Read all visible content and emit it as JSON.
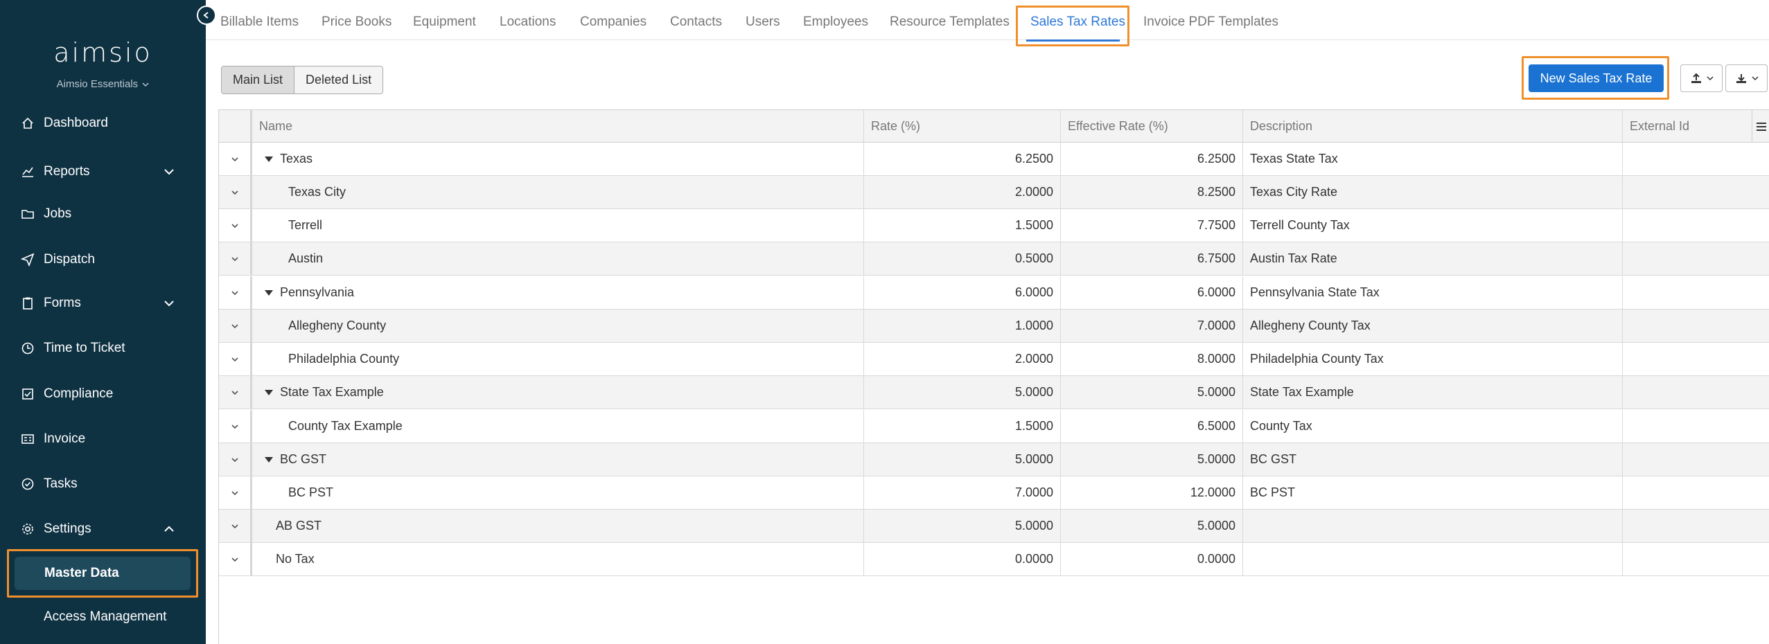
{
  "sidebar": {
    "logo": "aimsio",
    "org": "Aimsio Essentials",
    "items": [
      {
        "label": "Dashboard",
        "icon": "home-icon"
      },
      {
        "label": "Reports",
        "icon": "chart-icon"
      },
      {
        "label": "Jobs",
        "icon": "folder-icon"
      },
      {
        "label": "Dispatch",
        "icon": "send-icon"
      },
      {
        "label": "Forms",
        "icon": "clipboard-icon"
      },
      {
        "label": "Time to Ticket",
        "icon": "clock-icon"
      },
      {
        "label": "Compliance",
        "icon": "compliance-icon"
      },
      {
        "label": "Invoice",
        "icon": "invoice-icon"
      },
      {
        "label": "Tasks",
        "icon": "check-circle-icon"
      },
      {
        "label": "Settings",
        "icon": "gear-icon"
      }
    ],
    "active_item": "Master Data",
    "sub_item": "Access Management"
  },
  "tabs": [
    "Billable Items",
    "Price Books",
    "Equipment",
    "Locations",
    "Companies",
    "Contacts",
    "Users",
    "Employees",
    "Resource Templates",
    "Sales Tax Rates",
    "Invoice PDF Templates"
  ],
  "active_tab": "Sales Tax Rates",
  "toolbar": {
    "main_list": "Main List",
    "deleted_list": "Deleted List",
    "new_button": "New Sales Tax Rate"
  },
  "colors": {
    "sidebar_bg": "#0f3243",
    "accent_blue": "#1a73d2",
    "highlight_orange": "#f0902c"
  },
  "table": {
    "columns": [
      "Name",
      "Rate (%)",
      "Effective Rate (%)",
      "Description",
      "External Id"
    ],
    "rows": [
      {
        "name": "Texas",
        "rate": "6.2500",
        "effective": "6.2500",
        "description": "Texas State Tax",
        "external_id": "",
        "parent": true
      },
      {
        "name": "Texas City",
        "rate": "2.0000",
        "effective": "8.2500",
        "description": "Texas City Rate",
        "external_id": "",
        "child": true
      },
      {
        "name": "Terrell",
        "rate": "1.5000",
        "effective": "7.7500",
        "description": "Terrell County Tax",
        "external_id": "",
        "child": true
      },
      {
        "name": "Austin",
        "rate": "0.5000",
        "effective": "6.7500",
        "description": "Austin Tax Rate",
        "external_id": "",
        "child": true
      },
      {
        "name": "Pennsylvania",
        "rate": "6.0000",
        "effective": "6.0000",
        "description": "Pennsylvania State Tax",
        "external_id": "",
        "parent": true
      },
      {
        "name": "Allegheny County",
        "rate": "1.0000",
        "effective": "7.0000",
        "description": "Allegheny County Tax",
        "external_id": "",
        "child": true
      },
      {
        "name": "Philadelphia County",
        "rate": "2.0000",
        "effective": "8.0000",
        "description": "Philadelphia County Tax",
        "external_id": "",
        "child": true
      },
      {
        "name": "State Tax Example",
        "rate": "5.0000",
        "effective": "5.0000",
        "description": "State Tax Example",
        "external_id": "",
        "parent": true
      },
      {
        "name": "County Tax Example",
        "rate": "1.5000",
        "effective": "6.5000",
        "description": "County Tax",
        "external_id": "",
        "child": true
      },
      {
        "name": "BC GST",
        "rate": "5.0000",
        "effective": "5.0000",
        "description": "BC GST",
        "external_id": "",
        "parent": true
      },
      {
        "name": "BC PST",
        "rate": "7.0000",
        "effective": "12.0000",
        "description": "BC PST",
        "external_id": "",
        "child": true
      },
      {
        "name": "AB GST",
        "rate": "5.0000",
        "effective": "5.0000",
        "description": "",
        "external_id": ""
      },
      {
        "name": "No Tax",
        "rate": "0.0000",
        "effective": "0.0000",
        "description": "",
        "external_id": ""
      }
    ]
  }
}
